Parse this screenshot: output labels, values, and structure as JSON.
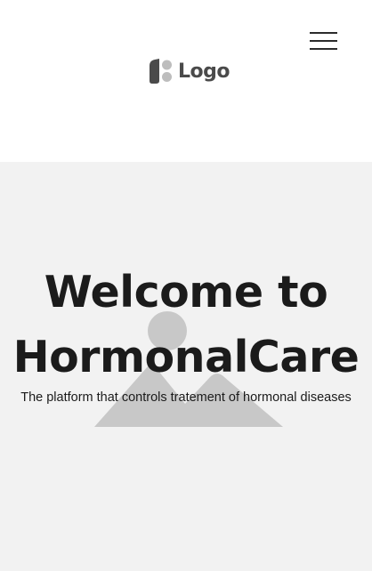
{
  "header": {
    "logo_text": "Logo",
    "logo_icon": "logo-mark-icon",
    "menu_icon": "hamburger-menu-icon"
  },
  "hero": {
    "title_line1": "Welcome to",
    "title_line2": "HormonalCare",
    "subtitle": "The platform that controls tratement of hormonal diseases",
    "background_icon": "image-placeholder-icon"
  },
  "colors": {
    "hero_background": "#f2f2f2",
    "header_background": "#ffffff",
    "text": "#1b1b1b",
    "placeholder": "#c8c8c8",
    "logo": "#4a4a4a"
  }
}
